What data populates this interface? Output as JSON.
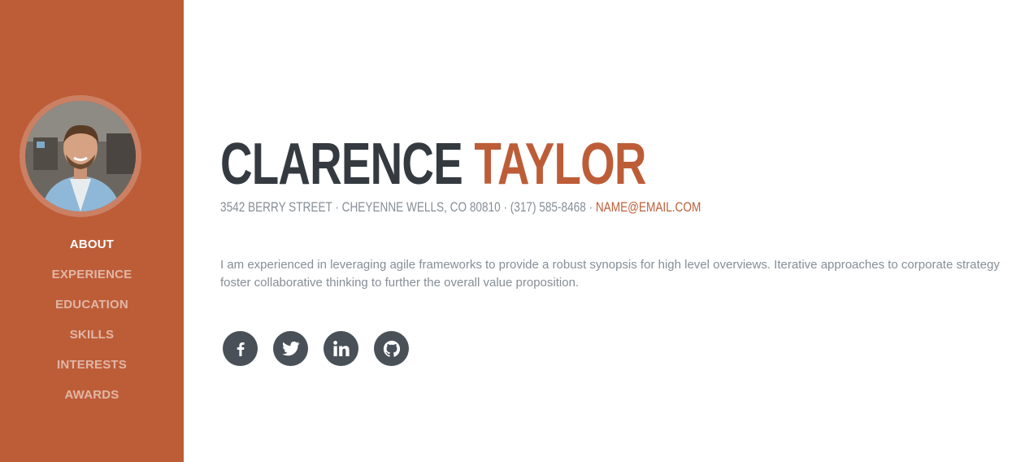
{
  "sidebar": {
    "nav": [
      {
        "label": "ABOUT",
        "active": true
      },
      {
        "label": "EXPERIENCE",
        "active": false
      },
      {
        "label": "EDUCATION",
        "active": false
      },
      {
        "label": "SKILLS",
        "active": false
      },
      {
        "label": "INTERESTS",
        "active": false
      },
      {
        "label": "AWARDS",
        "active": false
      }
    ]
  },
  "profile": {
    "first_name": "CLARENCE",
    "last_name": "TAYLOR",
    "address": "3542 BERRY STREET · CHEYENNE WELLS, CO 80810 · (317) 585-8468 · ",
    "email": "NAME@EMAIL.COM",
    "bio": "I am experienced in leveraging agile frameworks to provide a robust synopsis for high level overviews. Iterative approaches to corporate strategy foster collaborative thinking to further the overall value proposition."
  },
  "social": [
    {
      "icon": "facebook-icon"
    },
    {
      "icon": "twitter-icon"
    },
    {
      "icon": "linkedin-icon"
    },
    {
      "icon": "github-icon"
    }
  ],
  "colors": {
    "primary": "#bd5d38",
    "dark": "#343a40",
    "muted": "#868e96",
    "social_bg": "#495057"
  }
}
